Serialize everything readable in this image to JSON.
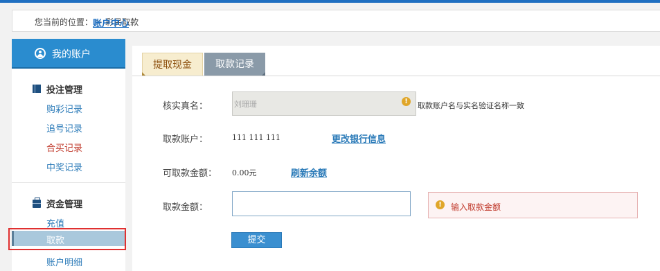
{
  "breadcrumb": {
    "prefix": "您当前的位置：",
    "link": "账户中心",
    "separator": ">",
    "current": "彩民取款"
  },
  "sidebar": {
    "account_title": "我的账户",
    "groups": [
      {
        "title": "投注管理",
        "icon": "book-icon",
        "items": [
          "购彩记录",
          "追号记录",
          "合买记录",
          "中奖记录"
        ]
      },
      {
        "title": "资金管理",
        "icon": "briefcase-icon",
        "items": [
          "充值",
          "取款",
          "账户明细"
        ]
      }
    ],
    "active_item": "取款",
    "highlight_color": "#e03030"
  },
  "tabs": {
    "withdraw": "提取现金",
    "records": "取款记录"
  },
  "form": {
    "realname_label": "核实真名：",
    "realname_value": "刘珊珊",
    "realname_hint": "取款账户名与实名验证名称一致",
    "account_label": "取款账户：",
    "account_value": "111  111  111",
    "change_bank_link": "更改银行信息",
    "available_label": "可取款金额：",
    "available_value": "0.00元",
    "refresh_link": "刷新余额",
    "amount_label": "取款金额：",
    "amount_value": "",
    "amount_error": "输入取款金额",
    "submit_label": "提交"
  },
  "colors": {
    "accent": "#2a8ccf",
    "link": "#2a7ab8",
    "error": "#c0392b",
    "warning_icon": "#e0a629"
  }
}
